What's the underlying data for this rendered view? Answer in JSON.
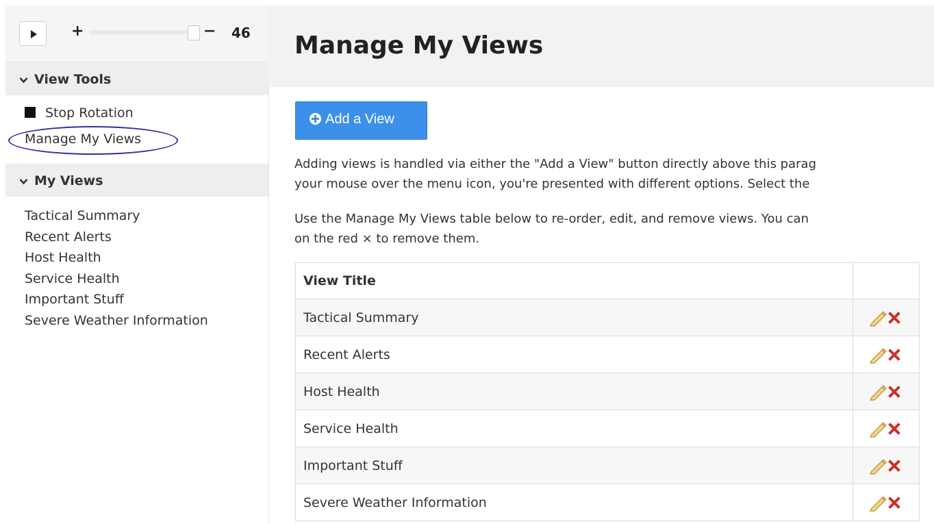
{
  "sidebar": {
    "controls": {
      "play_icon": "play-icon",
      "plus_label": "+",
      "minus_label": "−",
      "rotation_seconds": "46"
    },
    "view_tools": {
      "header": "View Tools",
      "stop_rotation": "Stop Rotation",
      "manage_views": "Manage My Views"
    },
    "my_views": {
      "header": "My Views",
      "items": [
        "Tactical Summary",
        "Recent Alerts",
        "Host Health",
        "Service Health",
        "Important Stuff",
        "Severe Weather Information"
      ]
    }
  },
  "main": {
    "title": "Manage My Views",
    "add_view_button": "Add a View",
    "paragraph1_line1": "Adding views is handled via either the \"Add a View\" button directly above this parag",
    "paragraph1_line2": "your mouse over the menu icon, you're presented with different options. Select the",
    "paragraph2_line1": "Use the Manage My Views table below to re-order, edit, and remove views. You can",
    "paragraph2_line2": "on the red × to remove them.",
    "table": {
      "header": "View Title",
      "rows": [
        "Tactical Summary",
        "Recent Alerts",
        "Host Health",
        "Service Health",
        "Important Stuff",
        "Severe Weather Information"
      ]
    }
  },
  "colors": {
    "accent_button": "#3d90ea",
    "highlight_oval": "#2b32a0",
    "remove_red": "#e0312a",
    "edit_pencil": "#e8c36a"
  }
}
